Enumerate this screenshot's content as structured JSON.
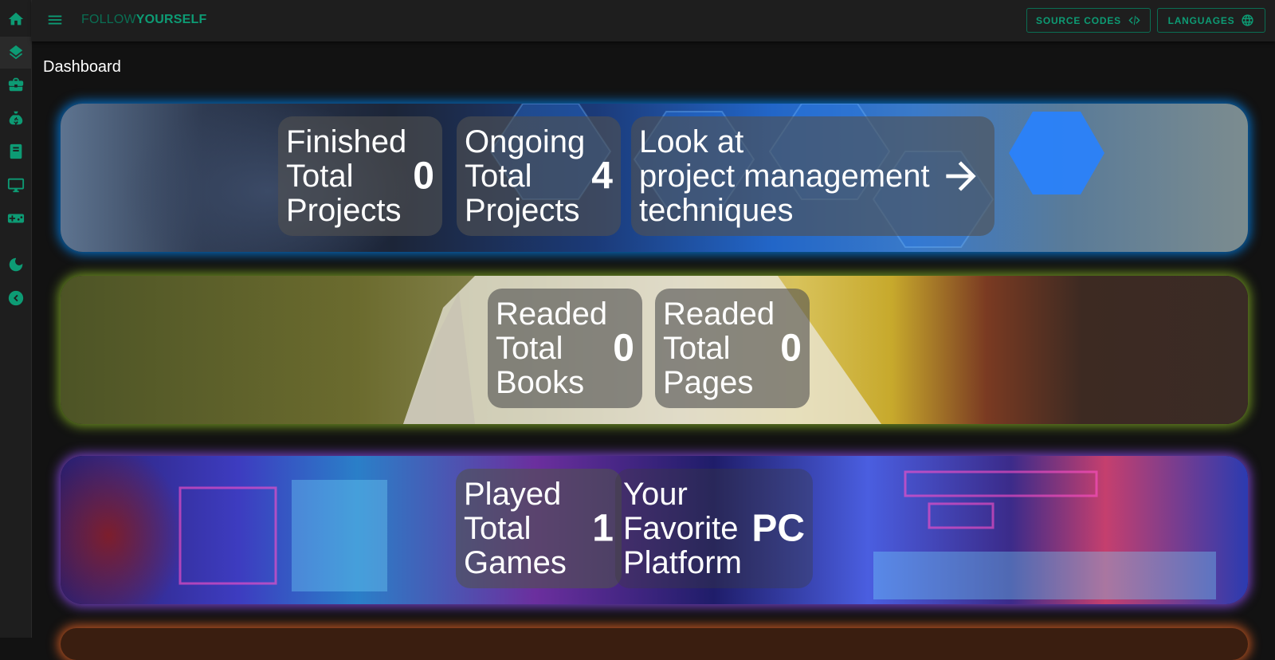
{
  "app": {
    "brand_thin": "FOLLOW",
    "brand_bold": "YOURSELF",
    "source_codes_label": "SOURCE CODES",
    "languages_label": "LANGUAGES"
  },
  "sidebar": {
    "items": [
      {
        "icon": "home-icon"
      },
      {
        "icon": "layers-icon"
      },
      {
        "icon": "briefcase-icon"
      },
      {
        "icon": "money-bag-icon"
      },
      {
        "icon": "book-icon"
      },
      {
        "icon": "monitor-icon"
      },
      {
        "icon": "gamepad-icon"
      },
      {
        "icon": "moon-icon"
      },
      {
        "icon": "collapse-icon"
      }
    ]
  },
  "page": {
    "title": "Dashboard"
  },
  "projects": {
    "finished_label": "Finished\nTotal\nProjects",
    "finished_value": "0",
    "ongoing_label": "Ongoing\nTotal\nProjects",
    "ongoing_value": "4",
    "techniques_label": "Look at\nproject management\ntechniques"
  },
  "books": {
    "books_label": "Readed\nTotal\nBooks",
    "books_value": "0",
    "pages_label": "Readed\nTotal\nPages",
    "pages_value": "0"
  },
  "games": {
    "games_label": "Played\nTotal\nGames",
    "games_value": "1",
    "platform_label": "Your\nFavorite\nPlatform",
    "platform_value": "PC"
  },
  "colors": {
    "accent": "#0d9b74",
    "projects_glow": "#008cff",
    "books_glow": "#96c828",
    "games_glow": "#9650ff",
    "next_glow": "#ff6e28"
  }
}
